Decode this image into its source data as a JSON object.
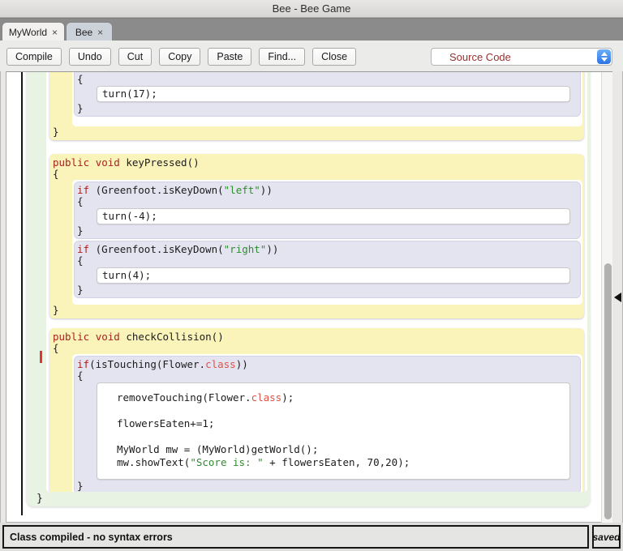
{
  "window": {
    "title": "Bee - Bee Game"
  },
  "titlebar": {
    "buttons": [
      {
        "name": "close",
        "color": "#ff5f58"
      },
      {
        "name": "minimize",
        "color": "#ffbd2e"
      },
      {
        "name": "zoom",
        "color": "#28c940"
      }
    ]
  },
  "tabs": [
    {
      "label": "MyWorld",
      "close_glyph": "×"
    },
    {
      "label": "Bee",
      "close_glyph": "×"
    }
  ],
  "toolbar": {
    "buttons": [
      "Compile",
      "Undo",
      "Cut",
      "Copy",
      "Paste",
      "Find...",
      "Close"
    ],
    "view_selector": {
      "value": "Source Code"
    }
  },
  "editor": {
    "colors": {
      "method_bg": "#faf3ba",
      "if_bg": "#e4e4f1",
      "class_bg": "#e9f3e3",
      "stmt_bg": "#ffffff",
      "keyword": "#a8241f",
      "type_keyword": "#df5147",
      "string": "#2f8b2f",
      "code_text": "#1c1c1c",
      "selector_text": "#9a3030"
    },
    "blocks": [
      {
        "kind": "method",
        "partial": true,
        "body": [
          {
            "kind": "if",
            "partial": true,
            "open": "{",
            "close": "}",
            "stmts": [
              {
                "lines": [
                  [
                    {
                      "t": "turn(17);",
                      "c": "p"
                    }
                  ]
                ]
              }
            ]
          }
        ],
        "close": "}"
      },
      {
        "kind": "method",
        "header": [
          {
            "t": "public",
            "c": "k"
          },
          {
            "t": " ",
            "c": "p"
          },
          {
            "t": "void",
            "c": "k"
          },
          {
            "t": " keyPressed()",
            "c": "p"
          }
        ],
        "open": "{",
        "body": [
          {
            "kind": "if",
            "cond": [
              {
                "t": "if",
                "c": "k"
              },
              {
                "t": " (Greenfoot.isKeyDown(",
                "c": "p"
              },
              {
                "t": "\"left\"",
                "c": "s"
              },
              {
                "t": "))",
                "c": "p"
              }
            ],
            "open": "{",
            "close": "}",
            "stmts": [
              {
                "lines": [
                  [
                    {
                      "t": "turn(-4);",
                      "c": "p"
                    }
                  ]
                ]
              }
            ]
          },
          {
            "kind": "if",
            "cond": [
              {
                "t": "if",
                "c": "k"
              },
              {
                "t": " (Greenfoot.isKeyDown(",
                "c": "p"
              },
              {
                "t": "\"right\"",
                "c": "s"
              },
              {
                "t": "))",
                "c": "p"
              }
            ],
            "open": "{",
            "close": "}",
            "stmts": [
              {
                "lines": [
                  [
                    {
                      "t": "turn(4);",
                      "c": "p"
                    }
                  ]
                ]
              }
            ]
          }
        ],
        "close": "}"
      },
      {
        "kind": "method",
        "header": [
          {
            "t": "public",
            "c": "k"
          },
          {
            "t": " ",
            "c": "p"
          },
          {
            "t": "void",
            "c": "k"
          },
          {
            "t": " checkCollision()",
            "c": "p"
          }
        ],
        "open": "{",
        "body": [
          {
            "kind": "if",
            "cond": [
              {
                "t": "if",
                "c": "k"
              },
              {
                "t": "(isTouching(Flower.",
                "c": "p"
              },
              {
                "t": "class",
                "c": "k2"
              },
              {
                "t": "))",
                "c": "p"
              }
            ],
            "open": "{",
            "close": "}",
            "stmts": [
              {
                "lines": [
                  [
                    {
                      "t": "removeTouching(Flower.",
                      "c": "p"
                    },
                    {
                      "t": "class",
                      "c": "k2"
                    },
                    {
                      "t": ");",
                      "c": "p"
                    }
                  ],
                  [],
                  [
                    {
                      "t": "flowersEaten+=1;",
                      "c": "p"
                    }
                  ],
                  [],
                  [
                    {
                      "t": "MyWorld mw = (MyWorld)getWorld();",
                      "c": "p"
                    }
                  ],
                  [
                    {
                      "t": "mw.showText(",
                      "c": "p"
                    },
                    {
                      "t": "\"Score is: \"",
                      "c": "s"
                    },
                    {
                      "t": " + flowersEaten, 70,20);",
                      "c": "p"
                    }
                  ]
                ]
              }
            ]
          }
        ],
        "close": "}"
      }
    ],
    "class_close": "}"
  },
  "status_bar": {
    "message": "Class compiled - no syntax errors",
    "save_indicator": "saved"
  }
}
